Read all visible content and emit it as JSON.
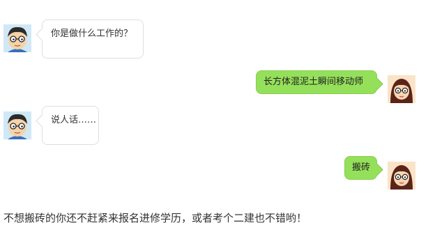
{
  "messages": [
    {
      "side": "left",
      "text": "你是做什么工作的？"
    },
    {
      "side": "right",
      "text": "长方体混泥土瞬间移动师"
    },
    {
      "side": "left",
      "text": "说人话……"
    },
    {
      "side": "right",
      "text": "搬砖"
    }
  ],
  "footer_text": "不想搬砖的你还不赶紧来报名进修学历，或者考个二建也不错哟！",
  "colors": {
    "right_bubble": "#95e05a",
    "left_bubble_border": "#dedede"
  },
  "icons": {
    "left_avatar": "boy-glasses-avatar-icon",
    "right_avatar": "girl-glasses-avatar-icon"
  }
}
